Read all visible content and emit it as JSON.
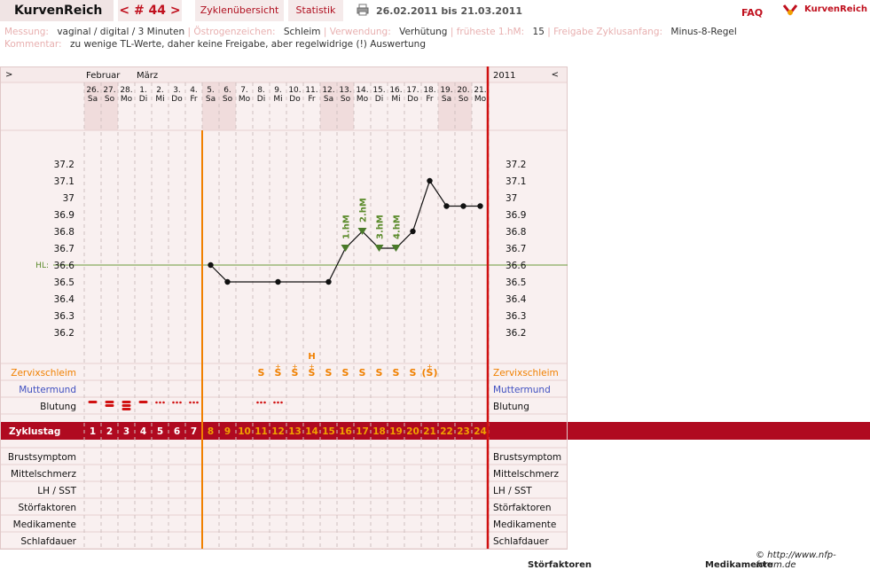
{
  "app": {
    "brand": "KurvenReich",
    "cycle_nav": "< # 44 >",
    "tab_overview": "Zyklenübersicht",
    "tab_stats": "Statistik",
    "date_range": "26.02.2011 bis 21.03.2011",
    "faq": "FAQ",
    "logo_text": "KurvenReich"
  },
  "info": {
    "messung_label": "Messung:",
    "messung_value": "vaginal / digital / 3 Minuten",
    "oestrogen_label": "Östrogenzeichen:",
    "oestrogen_value": "Schleim",
    "verwendung_label": "Verwendung:",
    "verwendung_value": "Verhütung",
    "hm_label": "früheste 1.hM:",
    "hm_value": "15",
    "freigabe_label": "Freigabe Zyklusanfang:",
    "freigabe_value": "Minus-8-Regel",
    "kommentar_label": "Kommentar:",
    "kommentar_value": "zu wenige TL-Werte, daher keine Freigabe, aber regelwidrige (!) Auswertung"
  },
  "header": {
    "left_arrow": ">",
    "right_arrow": "<",
    "year": "2011",
    "months": [
      {
        "label": "Februar",
        "col": 0
      },
      {
        "label": "März",
        "col": 3
      }
    ]
  },
  "days": [
    {
      "d": "26.",
      "w": "Sa",
      "we": true
    },
    {
      "d": "27.",
      "w": "So",
      "we": true
    },
    {
      "d": "28.",
      "w": "Mo",
      "we": false
    },
    {
      "d": "1.",
      "w": "Di",
      "we": false
    },
    {
      "d": "2.",
      "w": "Mi",
      "we": false
    },
    {
      "d": "3.",
      "w": "Do",
      "we": false
    },
    {
      "d": "4.",
      "w": "Fr",
      "we": false
    },
    {
      "d": "5.",
      "w": "Sa",
      "we": true
    },
    {
      "d": "6.",
      "w": "So",
      "we": true
    },
    {
      "d": "7.",
      "w": "Mo",
      "we": false
    },
    {
      "d": "8.",
      "w": "Di",
      "we": false
    },
    {
      "d": "9.",
      "w": "Mi",
      "we": false
    },
    {
      "d": "10.",
      "w": "Do",
      "we": false
    },
    {
      "d": "11.",
      "w": "Fr",
      "we": false
    },
    {
      "d": "12.",
      "w": "Sa",
      "we": true
    },
    {
      "d": "13.",
      "w": "So",
      "we": true
    },
    {
      "d": "14.",
      "w": "Mo",
      "we": false
    },
    {
      "d": "15.",
      "w": "Di",
      "we": false
    },
    {
      "d": "16.",
      "w": "Mi",
      "we": false
    },
    {
      "d": "17.",
      "w": "Do",
      "we": false
    },
    {
      "d": "18.",
      "w": "Fr",
      "we": false
    },
    {
      "d": "19.",
      "w": "Sa",
      "we": true
    },
    {
      "d": "20.",
      "w": "So",
      "we": true
    },
    {
      "d": "21.",
      "w": "Mo",
      "we": false
    }
  ],
  "y_ticks": [
    "37.2",
    "37.1",
    "37",
    "36.9",
    "36.8",
    "36.7",
    "36.6",
    "36.5",
    "36.4",
    "36.3",
    "36.2"
  ],
  "hl_label": "HL:",
  "hl_value": 36.6,
  "temperatures": [
    null,
    null,
    null,
    null,
    null,
    null,
    null,
    36.6,
    36.5,
    null,
    null,
    36.5,
    null,
    null,
    36.5,
    36.7,
    36.8,
    36.7,
    36.7,
    36.8,
    37.1,
    36.95,
    36.95,
    36.95
  ],
  "hm_markers": [
    {
      "col": 15,
      "label": "1.hM"
    },
    {
      "col": 16,
      "label": "2.hM"
    },
    {
      "col": 17,
      "label": "3.hM"
    },
    {
      "col": 18,
      "label": "4.hM"
    }
  ],
  "rows": {
    "zervix": "Zervixschleim",
    "muttermund": "Muttermund",
    "blutung": "Blutung",
    "zyklustag": "Zyklustag",
    "brust": "Brustsymptom",
    "mittel": "Mittelschmerz",
    "lh": "LH / SST",
    "stoer": "Störfaktoren",
    "medi": "Medikamente",
    "schlaf": "Schlafdauer"
  },
  "cervix": [
    "",
    "",
    "",
    "",
    "",
    "",
    "",
    "",
    "",
    "",
    "S",
    "S+",
    "S+",
    "S+",
    "S",
    "S",
    "S",
    "S",
    "S",
    "S",
    "(S+)",
    "",
    "",
    ""
  ],
  "cervix_extra": [
    {
      "col": 13,
      "text": "H"
    }
  ],
  "bleeding": [
    3,
    3,
    4,
    3,
    1,
    1,
    1,
    0,
    0,
    0,
    1,
    1,
    0,
    0,
    0,
    0,
    0,
    0,
    0,
    0,
    0,
    0,
    0,
    0
  ],
  "cycle_days": [
    "1",
    "2",
    "3",
    "4",
    "5",
    "6",
    "7",
    "8",
    "9",
    "10",
    "11",
    "12",
    "13",
    "14",
    "15",
    "16",
    "17",
    "18",
    "19",
    "20",
    "21",
    "22",
    "23",
    "24"
  ],
  "credit": "© http://www.nfp-forum.de",
  "bottom_left": "Störfaktoren",
  "bottom_right": "Medikamente",
  "colors": {
    "brand_red": "#b00a20",
    "orange": "#f08000",
    "green": "#5a8a2a",
    "blue": "#4050c0",
    "rose": "#f6eaea"
  }
}
